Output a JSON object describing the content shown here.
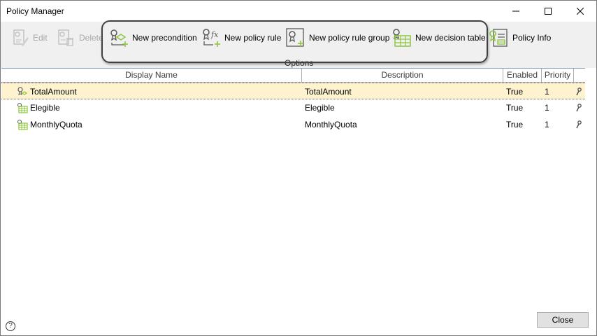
{
  "window": {
    "title": "Policy Manager"
  },
  "toolbar": {
    "edit_label": "Edit",
    "delete_label": "Delete",
    "new_precondition_label": "New precondition",
    "new_policy_rule_label": "New policy rule",
    "new_policy_rule_group_label": "New policy rule group",
    "new_decision_table_label": "New decision table",
    "policy_info_label": "Policy Info",
    "group_label": "Options"
  },
  "grid": {
    "columns": [
      "Display Name",
      "Description",
      "Enabled",
      "Priority"
    ],
    "rows": [
      {
        "name": "TotalAmount",
        "description": "TotalAmount",
        "enabled": "True",
        "priority": "1",
        "icon": "precondition-icon",
        "selected": true
      },
      {
        "name": "Elegible",
        "description": "Elegible",
        "enabled": "True",
        "priority": "1",
        "icon": "decision-table-icon",
        "selected": false
      },
      {
        "name": "MonthlyQuota",
        "description": "MonthlyQuota",
        "enabled": "True",
        "priority": "1",
        "icon": "decision-table-icon",
        "selected": false
      }
    ]
  },
  "footer": {
    "close_label": "Close",
    "help_glyph": "?"
  },
  "colors": {
    "accent_green": "#8dc63f",
    "selection": "#fff3cf",
    "icon_gray": "#5a5a5a"
  }
}
